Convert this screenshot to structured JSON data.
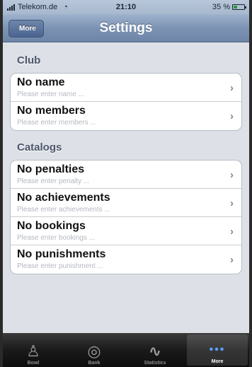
{
  "status_bar": {
    "carrier": "Telekom.de",
    "time": "21:10",
    "battery": "35 %"
  },
  "nav": {
    "back_label": "More",
    "title": "Settings"
  },
  "sections": [
    {
      "header": "Club",
      "rows": [
        {
          "title": "No name",
          "subtitle": "Please enter name ..."
        },
        {
          "title": "No members",
          "subtitle": "Please enter members ..."
        }
      ]
    },
    {
      "header": "Catalogs",
      "rows": [
        {
          "title": "No penalties",
          "subtitle": "Please enter penalty ..."
        },
        {
          "title": "No achievements",
          "subtitle": "Please enter achievements ..."
        },
        {
          "title": "No bookings",
          "subtitle": "Please enter bookings ..."
        },
        {
          "title": "No punishments",
          "subtitle": "Please enter punishment ..."
        }
      ]
    }
  ],
  "tab_bar": {
    "tabs": [
      {
        "label": "Bowl",
        "icon": "bowling-pins-icon"
      },
      {
        "label": "Bank",
        "icon": "coins-icon"
      },
      {
        "label": "Statistics",
        "icon": "line-chart-icon"
      },
      {
        "label": "More",
        "icon": "more-dots-icon"
      }
    ],
    "active_index": 3
  },
  "colors": {
    "nav_bar": "#7c93b3",
    "background": "#dde1e7",
    "tab_active": "#5aa0ff"
  }
}
